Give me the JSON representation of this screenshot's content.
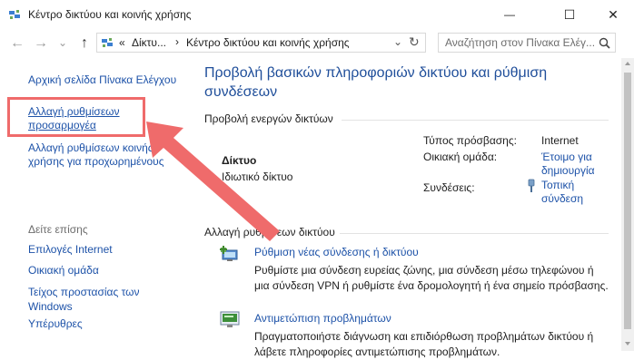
{
  "window": {
    "title": "Κέντρο δικτύου και κοινής χρήσης",
    "minimize_glyph": "—",
    "maximize_glyph": "☐",
    "close_glyph": "✕"
  },
  "nav": {
    "back_glyph": "←",
    "forward_glyph": "→",
    "dropdown_glyph": "⌄",
    "up_glyph": "↑"
  },
  "address": {
    "chevron": "«",
    "crumb1": "Δίκτυ...",
    "separator1": "›",
    "crumb2": "Κέντρο δικτύου και κοινής χρήσης",
    "dropdown_glyph": "⌄",
    "refresh_glyph": "↻"
  },
  "search": {
    "placeholder": "Αναζήτηση στον Πίνακα Ελέγ...",
    "icon": "search-icon"
  },
  "sidebar": {
    "home": "Αρχική σελίδα Πίνακα Ελέγχου",
    "adapter_line1": "Αλλαγή ρυθμίσεων",
    "adapter_line2": "προσαρμογέα",
    "advanced_line1": "Αλλαγή ρυθμίσεων κοινής",
    "advanced_line2": "χρήσης για προχωρημένους",
    "see_also": "Δείτε επίσης",
    "internet_options": "Επιλογές Internet",
    "homegroup": "Οικιακή ομάδα",
    "firewall_line1": "Τείχος προστασίας των",
    "firewall_line2": "Windows",
    "infrared": "Υπέρυθρες"
  },
  "main": {
    "heading_line1": "Προβολή βασικών πληροφοριών δικτύου και ρύθμιση",
    "heading_line2": "συνδέσεων",
    "active_networks": "Προβολή ενεργών δικτύων",
    "network_name": "Δίκτυο",
    "network_type": "Ιδιωτικό δίκτυο",
    "access_type_label": "Τύπος πρόσβασης:",
    "access_type_value": "Internet",
    "homegroup_label": "Οικιακή ομάδα:",
    "homegroup_value_line1": "Έτοιμο για",
    "homegroup_value_line2": "δημιουργία",
    "connections_label": "Συνδέσεις:",
    "connections_value_line1": "Τοπική",
    "connections_value_line2": "σύνδεση",
    "change_settings": "Αλλαγή ρυθμίσεων δικτύου",
    "setup_link": "Ρύθμιση νέας σύνδεσης ή δικτύου",
    "setup_desc_line1": "Ρυθμίστε μια σύνδεση ευρείας ζώνης, μια σύνδεση μέσω τηλεφώνου ή",
    "setup_desc_line2": "μια σύνδεση VPN ή ρυθμίστε ένα δρομολογητή ή ένα σημείο πρόσβασης.",
    "troubleshoot_link": "Αντιμετώπιση προβλημάτων",
    "troubleshoot_desc_line1": "Πραγματοποιήστε διάγνωση και επιδιόρθωση προβλημάτων δικτύου ή",
    "troubleshoot_desc_line2": "λάβετε πληροφορίες αντιμετώπισης προβλημάτων."
  },
  "colors": {
    "link": "#1d52a8",
    "heading": "#1f4e9a",
    "highlight": "#ef6b6b"
  }
}
